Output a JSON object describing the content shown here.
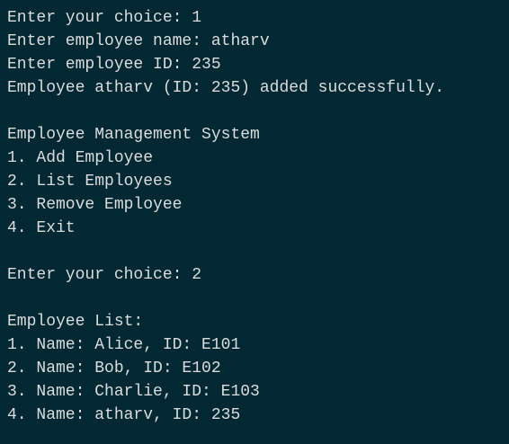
{
  "terminal": {
    "lines": [
      "Enter your choice: 1",
      "Enter employee name: atharv",
      "Enter employee ID: 235",
      "Employee atharv (ID: 235) added successfully.",
      "",
      "Employee Management System",
      "1. Add Employee",
      "2. List Employees",
      "3. Remove Employee",
      "4. Exit",
      "",
      "Enter your choice: 2",
      "",
      "Employee List:",
      "1. Name: Alice, ID: E101",
      "2. Name: Bob, ID: E102",
      "3. Name: Charlie, ID: E103",
      "4. Name: atharv, ID: 235"
    ]
  }
}
